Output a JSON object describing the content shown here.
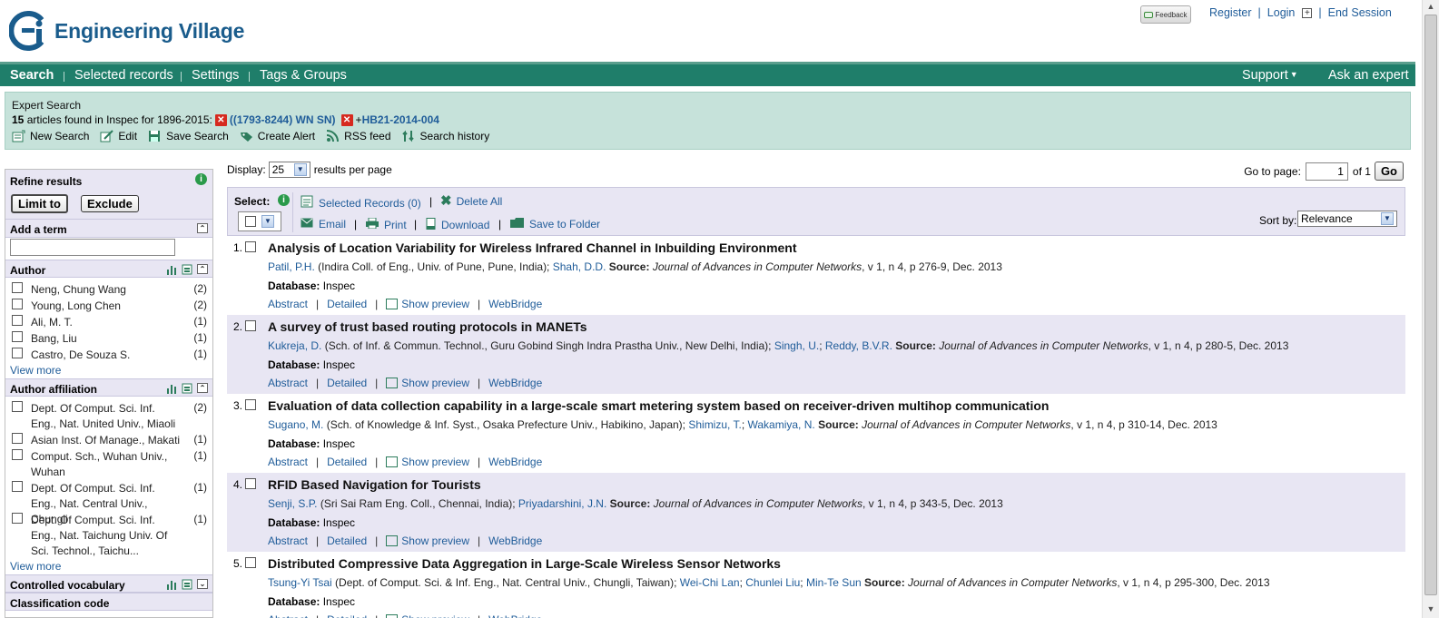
{
  "brand": {
    "name": "Engineering Village"
  },
  "top_links": {
    "feedback": "Feedback",
    "register": "Register",
    "login": "Login",
    "end_session": "End Session",
    "sep": "|"
  },
  "nav": {
    "items": [
      "Search",
      "Selected records",
      "Settings",
      "Tags & Groups"
    ],
    "support": "Support",
    "ask": "Ask an expert"
  },
  "search": {
    "type": "Expert Search",
    "count": "15",
    "found_text": "articles found in Inspec for 1896-2015:",
    "term1": "((1793-8244) WN SN)",
    "term2_prefix": "+",
    "term2": "HB21-2014-004",
    "tools": [
      "New Search",
      "Edit",
      "Save Search",
      "Create Alert",
      "RSS feed",
      "Search history"
    ]
  },
  "refine": {
    "title": "Refine results",
    "limit_to": "Limit to",
    "exclude": "Exclude",
    "add_term": "Add a term",
    "view_more": "View more",
    "author": {
      "title": "Author",
      "items": [
        {
          "label": "Neng, Chung Wang",
          "count": "(2)"
        },
        {
          "label": "Young, Long Chen",
          "count": "(2)"
        },
        {
          "label": "Ali, M. T.",
          "count": "(1)"
        },
        {
          "label": "Bang, Liu",
          "count": "(1)"
        },
        {
          "label": "Castro, De Souza S.",
          "count": "(1)"
        }
      ]
    },
    "affiliation": {
      "title": "Author affiliation",
      "items": [
        {
          "label": "Dept. Of Comput. Sci. Inf. Eng., Nat. United Univ., Miaoli",
          "count": "(2)"
        },
        {
          "label": "Asian Inst. Of Manage., Makati",
          "count": "(1)"
        },
        {
          "label": "Comput. Sch., Wuhan Univ., Wuhan",
          "count": "(1)"
        },
        {
          "label": "Dept. Of Comput. Sci. Inf. Eng., Nat. Central Univ., Chungli",
          "count": "(1)"
        },
        {
          "label": "Dept. Of Comput. Sci. Inf. Eng., Nat. Taichung Univ. Of Sci. Technol., Taichu...",
          "count": "(1)"
        }
      ]
    },
    "controlled": {
      "title": "Controlled vocabulary"
    },
    "classification": {
      "title": "Classification code"
    }
  },
  "display": {
    "label": "Display:",
    "value": "25",
    "suffix": "results per page",
    "goto_label": "Go to page:",
    "page": "1",
    "of": "of 1",
    "go": "Go"
  },
  "toolbar": {
    "select": "Select:",
    "selected_records": "Selected Records (0)",
    "delete_all": "Delete All",
    "email": "Email",
    "print": "Print",
    "download": "Download",
    "save_folder": "Save to Folder",
    "sort_label": "Sort by:",
    "sort_value": "Relevance"
  },
  "labels": {
    "database": "Database:",
    "source": "Source:",
    "abstract": "Abstract",
    "detailed": "Detailed",
    "show_preview": "Show preview",
    "webbridge": "WebBridge"
  },
  "records": [
    {
      "num": "1.",
      "title": "Analysis of Location Variability for Wireless Infrared Channel in Inbuilding Environment",
      "authors": [
        {
          "name": "Patil, P.H.",
          "aff": " (Indira Coll. of Eng., Univ. of Pune, Pune, India); "
        },
        {
          "name": "Shah, D.D.",
          "aff": " "
        }
      ],
      "journal": "Journal of Advances in Computer Networks",
      "detail": ", v 1, n 4, p 276-9, Dec. 2013",
      "database": "Inspec"
    },
    {
      "num": "2.",
      "title": "A survey of trust based routing protocols in MANETs",
      "authors": [
        {
          "name": "Kukreja, D.",
          "aff": " (Sch. of Inf. & Commun. Technol., Guru Gobind Singh Indra Prastha Univ., New Delhi, India); "
        },
        {
          "name": "Singh, U.",
          "aff": "; "
        },
        {
          "name": "Reddy, B.V.R.",
          "aff": " "
        }
      ],
      "journal": "Journal of Advances in Computer Networks",
      "detail": ", v 1, n 4, p 280-5, Dec. 2013",
      "database": "Inspec"
    },
    {
      "num": "3.",
      "title": "Evaluation of data collection capability in a large-scale smart metering system based on receiver-driven multihop communication",
      "authors": [
        {
          "name": "Sugano, M.",
          "aff": " (Sch. of Knowledge & Inf. Syst., Osaka Prefecture Univ., Habikino, Japan); "
        },
        {
          "name": "Shimizu, T.",
          "aff": "; "
        },
        {
          "name": "Wakamiya, N.",
          "aff": " "
        }
      ],
      "journal": "Journal of Advances in Computer Networks",
      "detail": ", v 1, n 4, p 310-14, Dec. 2013",
      "database": "Inspec"
    },
    {
      "num": "4.",
      "title": "RFID Based Navigation for Tourists",
      "authors": [
        {
          "name": "Senji, S.P.",
          "aff": " (Sri Sai Ram Eng. Coll., Chennai, India); "
        },
        {
          "name": "Priyadarshini, J.N.",
          "aff": " "
        }
      ],
      "journal": "Journal of Advances in Computer Networks",
      "detail": ", v 1, n 4, p 343-5, Dec. 2013",
      "database": "Inspec"
    },
    {
      "num": "5.",
      "title": "Distributed Compressive Data Aggregation in Large-Scale Wireless Sensor Networks",
      "authors": [
        {
          "name": "Tsung-Yi Tsai",
          "aff": " (Dept. of Comput. Sci. & Inf. Eng., Nat. Central Univ., Chungli, Taiwan); "
        },
        {
          "name": "Wei-Chi Lan",
          "aff": "; "
        },
        {
          "name": "Chunlei Liu",
          "aff": "; "
        },
        {
          "name": "Min-Te Sun",
          "aff": " "
        }
      ],
      "journal": "Journal of Advances in Computer Networks",
      "detail": ", v 1, n 4, p 295-300, Dec. 2013",
      "database": "Inspec"
    }
  ],
  "colors": {
    "nav": "#1f7e6a",
    "search_box": "#c6e2da",
    "lavender": "#e8e6f3",
    "link": "#1f5c99"
  }
}
